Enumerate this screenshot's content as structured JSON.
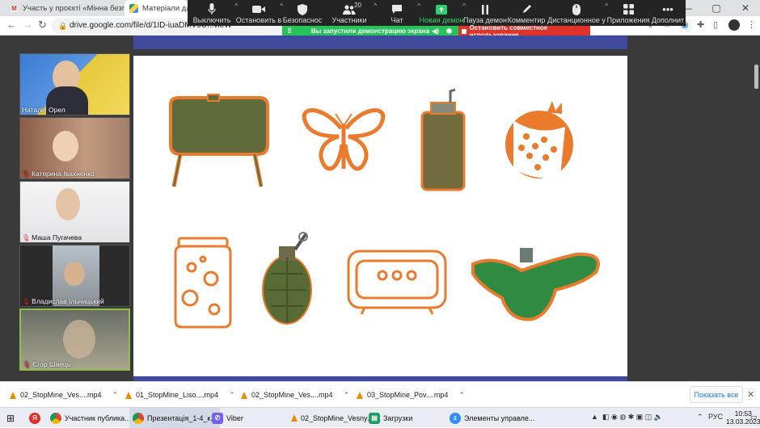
{
  "browser": {
    "tabs": [
      {
        "title": "Участь у проєкті «Мінна безпе...",
        "icon": "gmail-icon",
        "active": false
      },
      {
        "title": "Матеріали для за",
        "icon": "drive-icon",
        "active": true
      }
    ],
    "url": "drive.google.com/file/d/1ID-iuaDMV9U...vieW",
    "window_controls": [
      "—",
      "▢",
      "✕"
    ]
  },
  "zoom_toolbar": {
    "items": [
      {
        "label": "Выключить",
        "icon": "microphone-icon"
      },
      {
        "label": "Остановить в",
        "icon": "video-camera-icon"
      },
      {
        "label": "Безопаснос",
        "icon": "shield-icon"
      },
      {
        "label": "Участники",
        "icon": "participants-icon",
        "count": "20"
      },
      {
        "label": "Чат",
        "icon": "chat-icon"
      },
      {
        "label": "Новая демон",
        "icon": "share-screen-icon"
      },
      {
        "label": "Пауза демон",
        "icon": "pause-icon"
      },
      {
        "label": "Комментир",
        "icon": "annotate-icon"
      },
      {
        "label": "Дистанционное у",
        "icon": "remote-control-icon"
      },
      {
        "label": "Приложения",
        "icon": "apps-icon"
      },
      {
        "label": "Дополнит",
        "icon": "more-icon"
      }
    ]
  },
  "share_banner": {
    "status": "Вы запустили демонстрацию экрана",
    "stop": "Остановить совместное использование"
  },
  "participants": [
    {
      "name": "Наталія Орел",
      "muted": false
    },
    {
      "name": "Катерина Івахненко",
      "muted": true
    },
    {
      "name": "Маша Пугачева",
      "muted": true
    },
    {
      "name": "Владислав Ільницький",
      "muted": true
    },
    {
      "name": "Єгор Швець",
      "muted": true
    }
  ],
  "slide": {
    "items": [
      "mine-icon",
      "butterfly-icon",
      "grenade-canister-icon",
      "pomegranate-icon",
      "jar-icon",
      "hand-grenade-icon",
      "speaker-icon",
      "butterfly-mine-icon"
    ],
    "colors": {
      "orange": "#ec7a2c",
      "olive": "#5f6b3a",
      "green": "#2f8a42"
    }
  },
  "downloads": {
    "items": [
      "02_StopMine_Ves....mp4",
      "01_StopMine_Liso....mp4",
      "02_StopMine_Ves....mp4",
      "03_StopMine_Pov....mp4"
    ],
    "show_all": "Показать все"
  },
  "taskbar": {
    "apps": [
      "Участник публика...",
      "Презентація_1-4_к...",
      "Viber",
      "02_StopMine_Vesny...",
      "Загрузки",
      "Элементы управле..."
    ],
    "language": "РУС",
    "time": "10:53",
    "date": "13.03.2023"
  }
}
